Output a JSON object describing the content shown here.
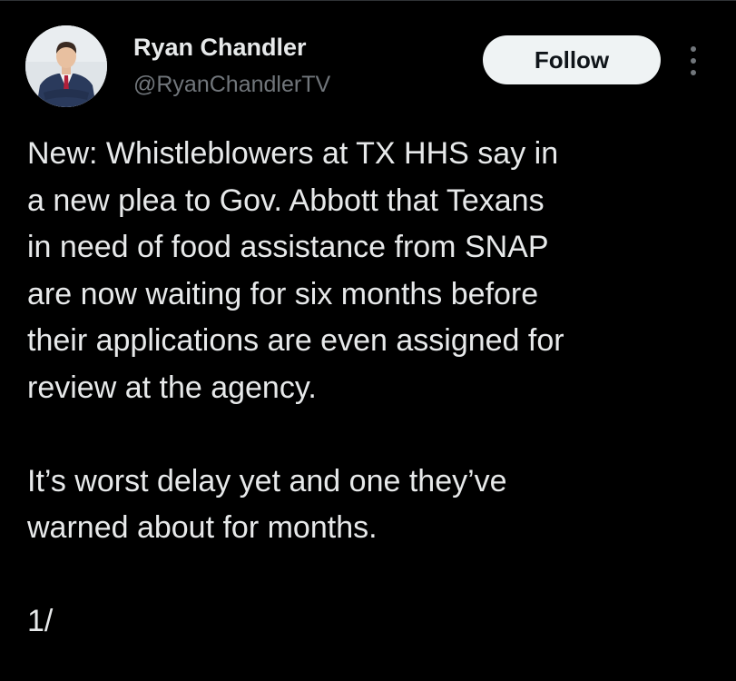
{
  "author": {
    "name": "Ryan Chandler",
    "handle": "@RyanChandlerTV",
    "avatar_icon": "profile-photo"
  },
  "actions": {
    "follow_label": "Follow",
    "more_icon": "more-options-icon"
  },
  "tweet": {
    "lines_p1": [
      "New: Whistleblowers at TX HHS say in",
      "a new plea to Gov. Abbott that Texans",
      "in need of food assistance from SNAP",
      "are now waiting for six months before",
      "their applications are even assigned for",
      "review at the agency."
    ],
    "lines_p2": [
      "It’s worst delay yet and one they’ve",
      "warned about for months."
    ],
    "thread_marker": "1/"
  },
  "colors": {
    "background": "#000000",
    "text_primary": "#e7e9ea",
    "text_secondary": "#71767b",
    "follow_bg": "#eff3f4",
    "follow_text": "#0f1419"
  }
}
